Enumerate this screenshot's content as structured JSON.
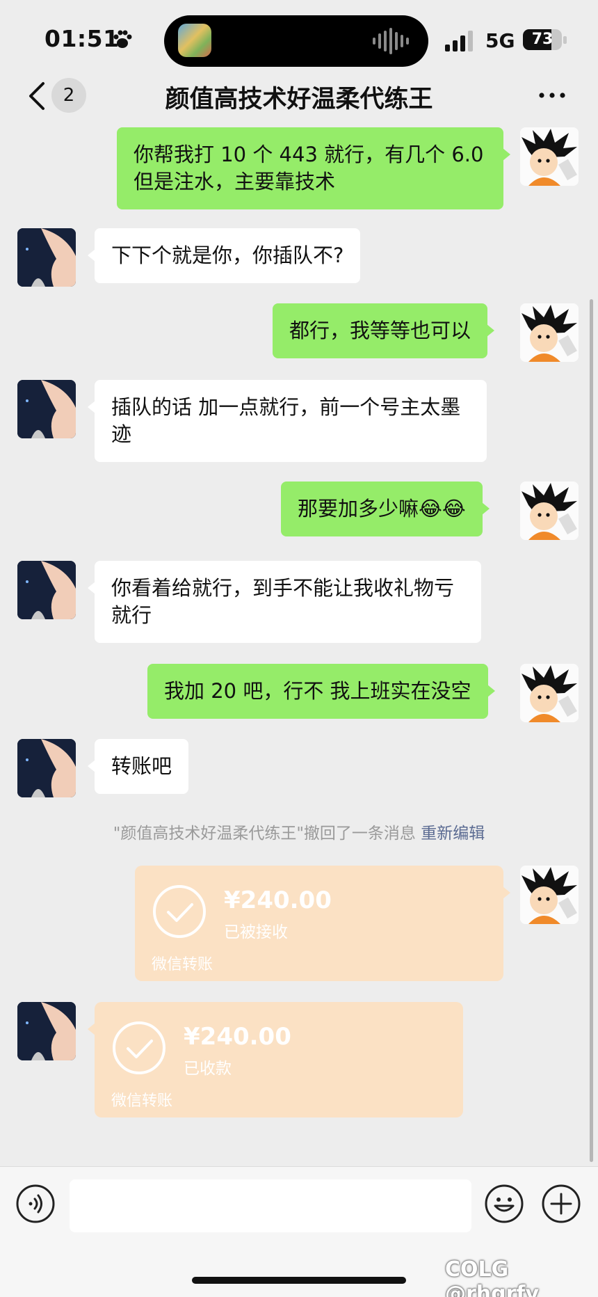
{
  "status_bar": {
    "time": "01:51",
    "network": "5G",
    "battery": "73",
    "battery_level": 0.73
  },
  "nav": {
    "unread_badge": "2",
    "title": "颜值高技术好温柔代练王"
  },
  "messages": [
    {
      "sender": "me",
      "text": "你帮我打 10 个 443 就行，有几个 6.0 但是注水，主要靠技术"
    },
    {
      "sender": "her",
      "text": "下下个就是你，你插队不?"
    },
    {
      "sender": "me",
      "text": "都行，我等等也可以"
    },
    {
      "sender": "her",
      "text": "插队的话 加一点就行，前一个号主太墨迹"
    },
    {
      "sender": "me",
      "text": "那要加多少嘛😂😂"
    },
    {
      "sender": "her",
      "text": "你看着给就行，到手不能让我收礼物亏就行"
    },
    {
      "sender": "me",
      "text": "我加 20 吧，行不 我上班实在没空"
    },
    {
      "sender": "her",
      "text": "转账吧"
    }
  ],
  "recall_notice": {
    "text": "\"颜值高技术好温柔代练王\"撤回了一条消息",
    "action": "重新编辑"
  },
  "transfers": [
    {
      "sender": "me",
      "amount": "¥240.00",
      "status": "已被接收",
      "label": "微信转账"
    },
    {
      "sender": "her",
      "amount": "¥240.00",
      "status": "已收款",
      "label": "微信转账"
    }
  ],
  "input": {
    "placeholder": ""
  },
  "watermark": "COLG @rhgrfv",
  "colors": {
    "me_bubble": "#95ec69",
    "her_bubble": "#ffffff",
    "transfer": "#fbe1c4",
    "background": "#ededed"
  }
}
